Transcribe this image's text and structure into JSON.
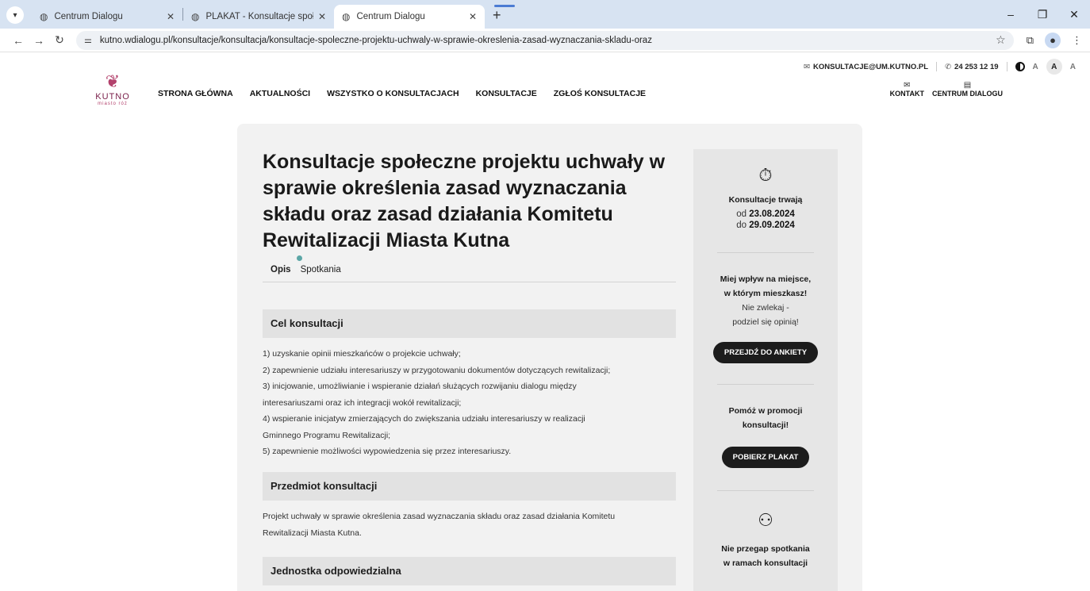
{
  "browser": {
    "tabs": [
      {
        "title": "Centrum Dialogu"
      },
      {
        "title": "PLAKAT - Konsultacje społeczne"
      },
      {
        "title": "Centrum Dialogu"
      }
    ],
    "url": "kutno.wdialogu.pl/konsultacje/konsultacja/konsultacje-spoleczne-projektu-uchwaly-w-sprawie-okreslenia-zasad-wyznaczania-skladu-oraz"
  },
  "topbar": {
    "email": "KONSULTACJE@UM.KUTNO.PL",
    "phone": "24 253 12 19",
    "font_small": "A",
    "font_mid": "A",
    "font_big": "A"
  },
  "logo": {
    "name": "KUTNO",
    "tagline": "miasto róż"
  },
  "nav": {
    "items": [
      "STRONA GŁÓWNA",
      "AKTUALNOŚCI",
      "WSZYSTKO O KONSULTACJACH",
      "KONSULTACJE",
      "ZGŁOŚ KONSULTACJE"
    ],
    "right": [
      "KONTAKT",
      "CENTRUM DIALOGU"
    ]
  },
  "content": {
    "title": "Konsultacje społeczne projektu uchwały w sprawie określenia zasad wyznaczania składu oraz zasad działania Komitetu Rewitalizacji Miasta Kutna",
    "tabs": [
      "Opis",
      "Spotkania"
    ],
    "sections": [
      {
        "heading": "Cel konsultacji",
        "lines": [
          "1) uzyskanie opinii mieszkańców o projekcie uchwały;",
          "2) zapewnienie udziału interesariuszy w przygotowaniu dokumentów dotyczących rewitalizacji;",
          "3) inicjowanie, umożliwianie i wspieranie działań służących rozwijaniu dialogu między",
          "interesariuszami oraz ich integracji wokół rewitalizacji;",
          "4) wspieranie inicjatyw zmierzających do zwiększania udziału interesariuszy w realizacji",
          "Gminnego Programu Rewitalizacji;",
          "5) zapewnienie możliwości wypowiedzenia się przez interesariuszy."
        ]
      },
      {
        "heading": "Przedmiot konsultacji",
        "lines": [
          "Projekt uchwały w sprawie określenia zasad wyznaczania składu oraz zasad działania Komitetu",
          "Rewitalizacji Miasta Kutna."
        ]
      },
      {
        "heading": "Jednostka odpowiedzialna",
        "lines": []
      }
    ]
  },
  "sidebar": {
    "duration_label": "Konsultacje trwają",
    "from_prefix": "od",
    "from_date": "23.08.2024",
    "to_prefix": "do",
    "to_date": "29.09.2024",
    "survey_bold_1": "Miej wpływ na miejsce,",
    "survey_bold_2": "w którym mieszkasz!",
    "survey_text_1": "Nie zwlekaj -",
    "survey_text_2": "podziel się opinią!",
    "survey_button": "PRZEJDŹ DO ANKIETY",
    "promo_1": "Pomóż w promocji",
    "promo_2": "konsultacji!",
    "poster_button": "POBIERZ PLAKAT",
    "meeting_1": "Nie przegap spotkania",
    "meeting_2": "w ramach konsultacji"
  }
}
